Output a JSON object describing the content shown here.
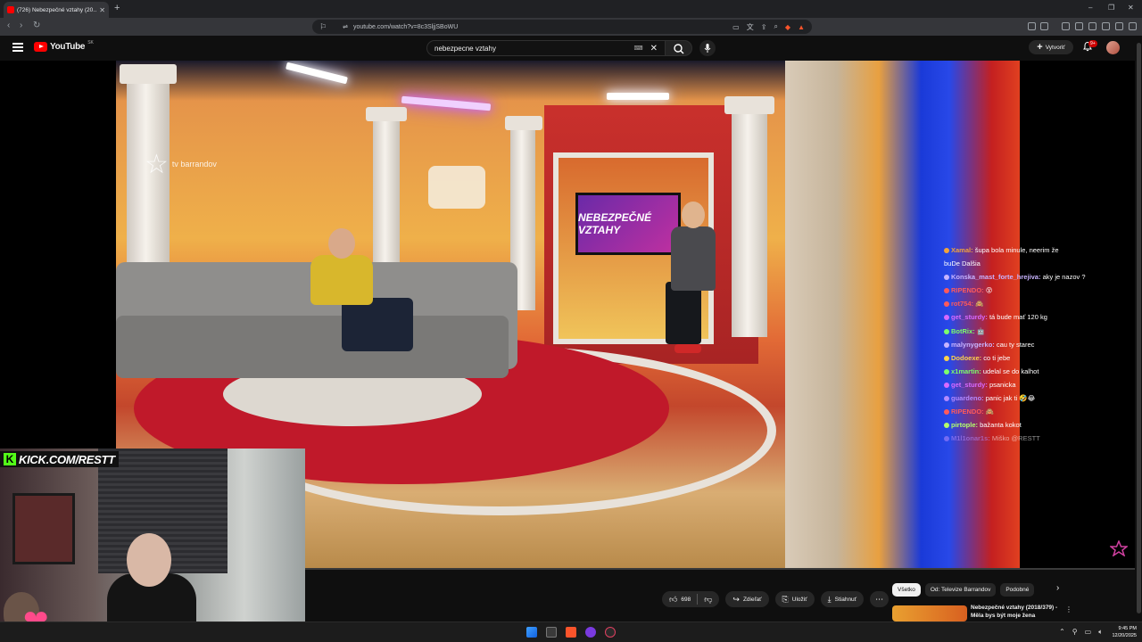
{
  "browser": {
    "tab_title": "(726) Nebezpečné vztahy (20…",
    "new_tab_icon": "plus-icon",
    "url": "youtube.com/watch?v=8c3SljjSBoWU"
  },
  "youtube": {
    "logo_text": "YouTube",
    "country_code": "SK",
    "search_value": "nebezpecne vztahy",
    "create_label": "Vytvoriť",
    "notification_badge": "9+"
  },
  "video": {
    "watermark_brand": "tv barrandov",
    "screen_text": "NEBEZPEČNÉ VZTAHY",
    "kick_label": "KICK.COM/RESTT"
  },
  "chat": [
    {
      "user": "Xamal:",
      "text": "šupa bola minule, neerim že",
      "color": "#f2a33c",
      "dim": false
    },
    {
      "user": "",
      "text": "buDe Dalšia",
      "color": "#ffffff",
      "dim": false
    },
    {
      "user": "Konska_mast_forte_hrejiva:",
      "text": "aky je nazov ?",
      "color": "#c8b4ff",
      "dim": false
    },
    {
      "user": "RIPENDO:",
      "text": "😵",
      "color": "#ff5a5a",
      "dim": false
    },
    {
      "user": "rot754:",
      "text": "🙈",
      "color": "#ff5a5a",
      "dim": false
    },
    {
      "user": "get_sturdy:",
      "text": "tá bude mať 120 kg",
      "color": "#d86aff",
      "dim": false
    },
    {
      "user": "BotRix:",
      "text": "🤖",
      "color": "#7cff6a",
      "dim": false
    },
    {
      "user": "malynygerko:",
      "text": "cau ty starec",
      "color": "#c8b4ff",
      "dim": false
    },
    {
      "user": "Dodoexe:",
      "text": "co ti jebe",
      "color": "#ffd24a",
      "dim": false
    },
    {
      "user": "x1martin:",
      "text": "udelal se do kalhot",
      "color": "#7cff6a",
      "dim": false
    },
    {
      "user": "get_sturdy:",
      "text": "psanicka",
      "color": "#d86aff",
      "dim": false
    },
    {
      "user": "guardeno:",
      "text": "panic jak ti 🤣😂",
      "color": "#b48aff",
      "dim": false
    },
    {
      "user": "RIPENDO:",
      "text": "🙈",
      "color": "#ff5a5a",
      "dim": false
    },
    {
      "user": "pirtople:",
      "text": "bažanta kokot",
      "color": "#b4ff6a",
      "dim": false
    },
    {
      "user": "M1l1onar1s:",
      "text": "Miško @RESTT",
      "color": "#b48aff",
      "dim": true
    }
  ],
  "actions": {
    "likes": "698",
    "share": "Zdieľať",
    "save": "Uložiť",
    "download": "Stiahnuť"
  },
  "chips": [
    "Všetko",
    "Od: Televize Barrandov",
    "Podobné"
  ],
  "suggestion": {
    "title": "Nebezpečné vztahy (2018/379) - Měla bys být moje žena"
  },
  "taskbar": {
    "time": "9:45 PM",
    "date": "12/20/2025"
  }
}
